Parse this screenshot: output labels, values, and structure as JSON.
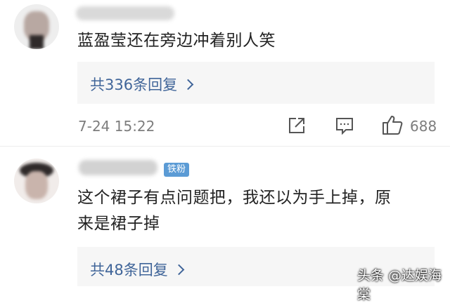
{
  "comments": [
    {
      "text": "蓝盈莹还在旁边冲着别人笑",
      "replies_label": "共336条回复",
      "timestamp": "7-24 15:22",
      "like_count": "688"
    },
    {
      "badge": "铁粉",
      "text_line1": "这个裙子有点问题把，我还以为手上掉，原",
      "text_line2": "来是裙子掉",
      "replies_label": "共48条回复"
    }
  ],
  "watermark": "头条 @达娱海棠",
  "icons": [
    "share-icon",
    "comment-icon",
    "like-icon",
    "chevron-right-icon"
  ],
  "colors": {
    "link": "#406599",
    "badge": "#5b9bd5",
    "reply_bg": "#f6f6f6"
  }
}
